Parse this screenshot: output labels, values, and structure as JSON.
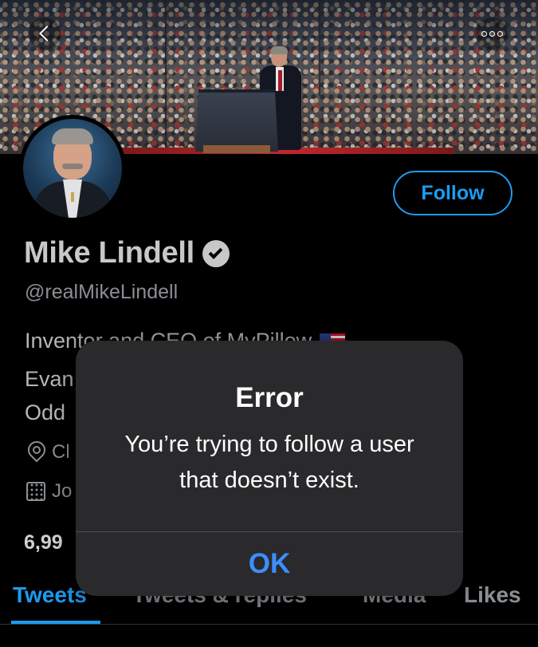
{
  "profile": {
    "name": "Mike Lindell",
    "handle": "@realMikeLindell",
    "follow_label": "Follow",
    "bio_line_1": "Inventor and CEO of MyPillow",
    "bio_line_2": "Evan",
    "bio_line_3": "Odd",
    "location_partial": "Cl",
    "joined_partial": "Jo",
    "counts_partial": "6,99"
  },
  "tabs": [
    {
      "label": "Tweets",
      "active": true
    },
    {
      "label": "Tweets & replies",
      "active": false
    },
    {
      "label": "Media",
      "active": false
    },
    {
      "label": "Likes",
      "active": false
    }
  ],
  "dialog": {
    "title": "Error",
    "message": "You’re trying to follow a user that doesn’t exist.",
    "ok_label": "OK"
  },
  "colors": {
    "accent": "#1d9bf0",
    "dialog_button": "#3d8eff",
    "background": "#000000",
    "dialog_background": "#2a2a2c"
  },
  "icons": {
    "back": "back-chevron-icon",
    "more": "more-options-icon",
    "verified": "verified-badge-icon",
    "location": "location-pin-icon",
    "joined": "calendar-icon",
    "flag": "us-flag-icon"
  }
}
